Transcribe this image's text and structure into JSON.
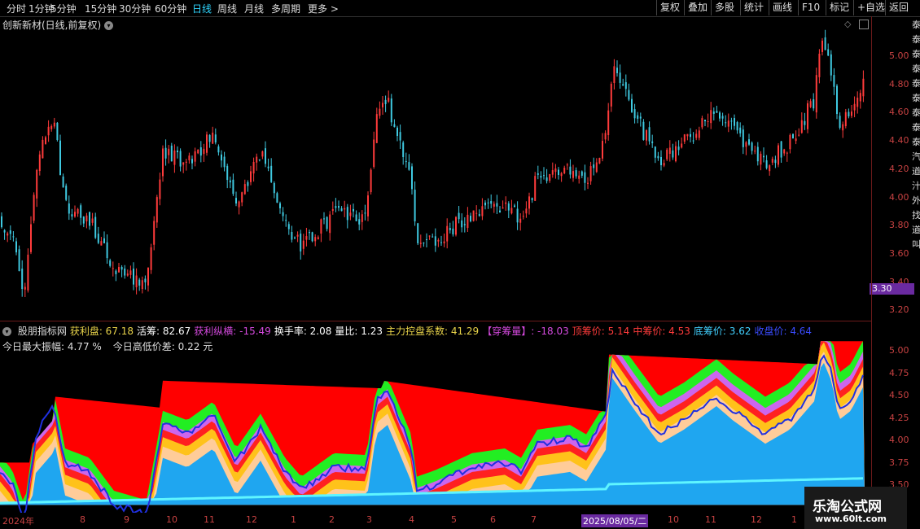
{
  "toolbar": {
    "timeframes": [
      "分时",
      "1分钟",
      "5分钟",
      "15分钟",
      "30分钟",
      "60分钟",
      "日线",
      "周线",
      "月线",
      "多周期",
      "更多 >"
    ],
    "active": "日线",
    "right_buttons": [
      "复权",
      "叠加",
      "多股",
      "统计",
      "画线",
      "F10",
      "标记",
      "+自选",
      "返回"
    ]
  },
  "chart_title": "创新新材(日线,前复权)",
  "price_axis": [
    "5.00",
    "4.80",
    "4.60",
    "4.40",
    "4.20",
    "4.00",
    "3.80",
    "3.60",
    "3.40",
    "3.20"
  ],
  "current_price_tag": "3.30",
  "indicator": {
    "name": "股朋指标网",
    "items": [
      {
        "label": "获利盘: 67.18",
        "color": "#e8d34a"
      },
      {
        "label": "活筹: 82.67",
        "color": "#ffffff"
      },
      {
        "label": "获利纵横: -15.49",
        "color": "#d64ae0"
      },
      {
        "label": "换手率: 2.08",
        "color": "#ffffff"
      },
      {
        "label": "量比: 1.23",
        "color": "#ffffff"
      },
      {
        "label": "主力控盘系数: 41.29",
        "color": "#e8d34a"
      },
      {
        "label": "【穿筹量】: -18.03",
        "color": "#d64ae0"
      },
      {
        "label": "顶筹价: 5.14",
        "color": "#ff3b3b"
      },
      {
        "label": "中筹价: 4.53",
        "color": "#ff3b3b"
      },
      {
        "label": "底筹价: 3.62",
        "color": "#41d0ff"
      },
      {
        "label": "收盘价: 4.64",
        "color": "#3a4cff"
      }
    ],
    "line2": [
      "今日最大振幅: 4.77 %",
      "今日高低价差: 0.22 元"
    ]
  },
  "lower_axis": [
    "5.00",
    "4.75",
    "4.50",
    "4.25",
    "4.00",
    "3.75",
    "3.50"
  ],
  "dates": [
    "2024年",
    "8",
    "9",
    "10",
    "11",
    "12",
    "1",
    "2",
    "3",
    "4",
    "5",
    "6",
    "7",
    "2025/08/05/二",
    "10",
    "11",
    "12",
    "1"
  ],
  "side_text": "泰泰泰泰泰泰泰泰泰汽道汁外找道叫",
  "watermark": {
    "title": "乐淘公式网",
    "url": "www.60lt.com"
  },
  "colors": {
    "up": "#ff3b3b",
    "down": "#3fc9e0",
    "band_top": "#ff0000",
    "band_base": "#1fa6f0"
  }
}
